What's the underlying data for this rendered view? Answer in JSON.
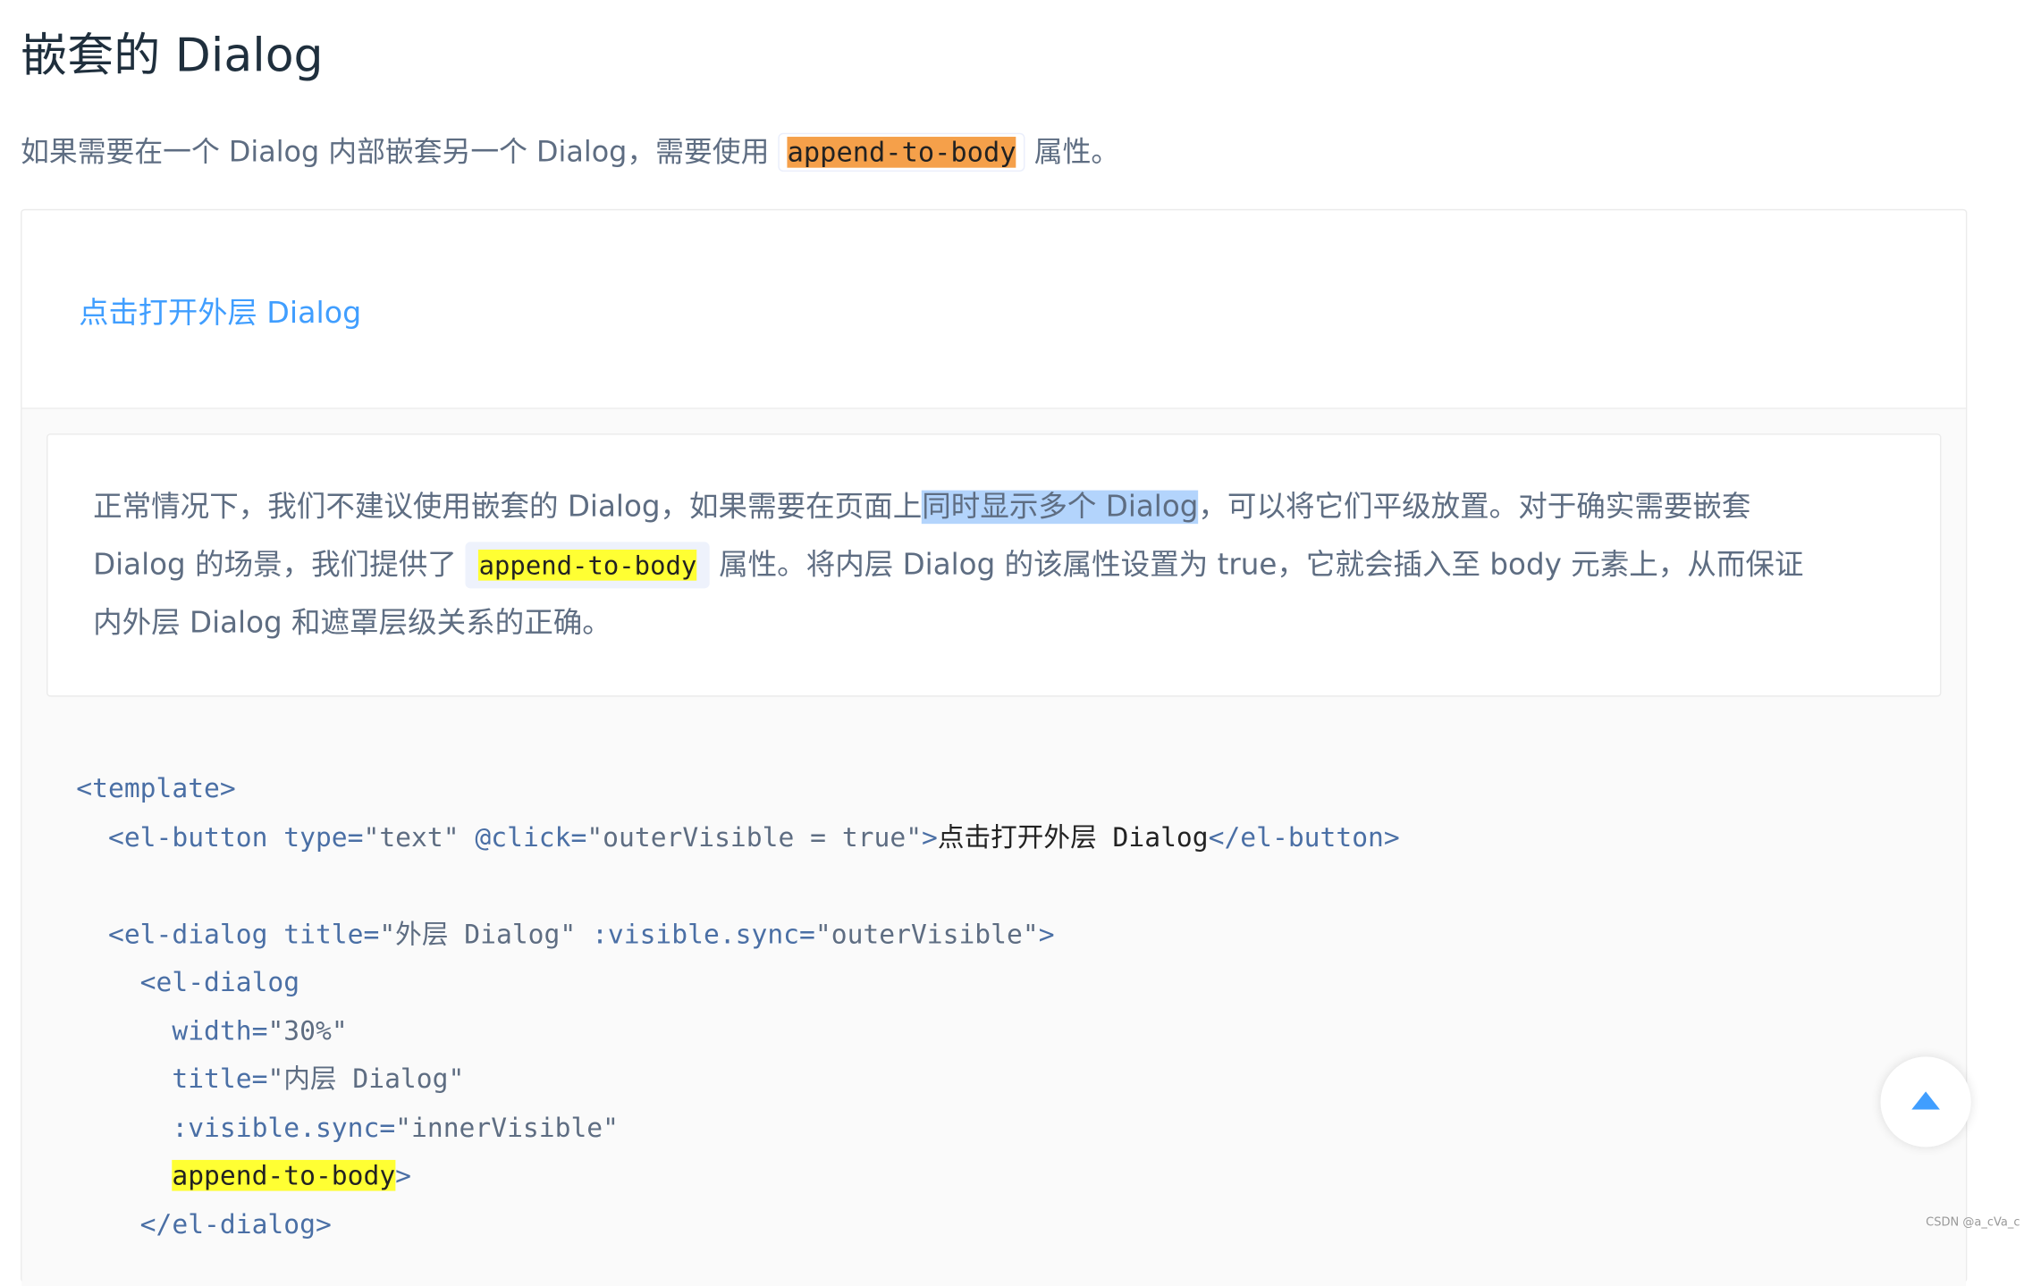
{
  "title": "嵌套的 Dialog",
  "intro": {
    "before": "如果需要在一个 Dialog 内部嵌套另一个 Dialog，需要使用 ",
    "code": "append-to-body",
    "after": " 属性。"
  },
  "demo": {
    "open_button_label": "点击打开外层 Dialog",
    "description": {
      "part1": "正常情况下，我们不建议使用嵌套的 Dialog，如果需要在页面上",
      "selected": "同时显示多个 Dialog",
      "part2": "，可以将它们平级放置。对于确实需要嵌套",
      "part3": "Dialog 的场景，我们提供了 ",
      "code": "append-to-body",
      "part4": " 属性。将内层 Dialog 的该属性设置为 true，它就会插入至 body 元素上，从而保证",
      "part5": "内外层 Dialog 和遮罩层级关系的正确。"
    },
    "code": {
      "l1": "<template>",
      "l2_tag_open": "<el-button",
      "l2_attr1": " type=",
      "l2_val1": "\"text\"",
      "l2_attr2": " @click=",
      "l2_val2": "\"outerVisible = true\"",
      "l2_gt": ">",
      "l2_text": "点击打开外层 Dialog",
      "l2_tag_close": "</el-button>",
      "l4_tag_open": "<el-dialog",
      "l4_attr1": " title=",
      "l4_val1": "\"外层 Dialog\"",
      "l4_attr2": " :visible.sync=",
      "l4_val2": "\"outerVisible\"",
      "l4_gt": ">",
      "l5": "<el-dialog",
      "l6_attr": "width=",
      "l6_val": "\"30%\"",
      "l7_attr": "title=",
      "l7_val": "\"内层 Dialog\"",
      "l8_attr": ":visible.sync=",
      "l8_val": "\"innerVisible\"",
      "l9_attr": "append-to-body",
      "l9_gt": ">",
      "l10": "</el-dialog>"
    }
  },
  "watermark": "CSDN @a_cVa_c",
  "icons": {
    "back_to_top": "caret-up-icon"
  },
  "colors": {
    "link": "#409eff",
    "highlight_yellow": "#ffff33",
    "highlight_orange": "#f5a04a",
    "selection": "#b3d4fc"
  }
}
